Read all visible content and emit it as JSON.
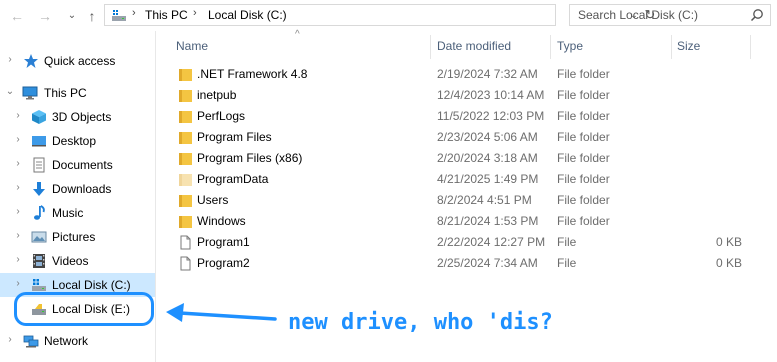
{
  "toolbar": {
    "back_glyph": "←",
    "forward_glyph": "→",
    "recent_glyph": "⌄",
    "up_glyph": "↑"
  },
  "address": {
    "crumbs": [
      "This PC",
      "Local Disk (C:)"
    ],
    "separator": "›",
    "dropdown_glyph": "⌄",
    "refresh_glyph": "↻"
  },
  "search": {
    "placeholder": "Search Local Disk (C:)"
  },
  "nav": {
    "chevron_collapsed": "›",
    "chevron_expanded": "⌄",
    "items": [
      {
        "label": "Quick access",
        "icon": "star-icon"
      },
      {
        "label": "This PC",
        "icon": "computer-icon",
        "expanded": true
      },
      {
        "label": "3D Objects",
        "icon": "cube-icon"
      },
      {
        "label": "Desktop",
        "icon": "desktop-icon"
      },
      {
        "label": "Documents",
        "icon": "documents-icon"
      },
      {
        "label": "Downloads",
        "icon": "download-arrow-icon"
      },
      {
        "label": "Music",
        "icon": "music-note-icon"
      },
      {
        "label": "Pictures",
        "icon": "pictures-icon"
      },
      {
        "label": "Videos",
        "icon": "film-strip-icon"
      },
      {
        "label": "Local Disk (C:)",
        "icon": "windows-drive-icon",
        "selected": true
      },
      {
        "label": "Local Disk (E:)",
        "icon": "usb-drive-icon"
      },
      {
        "label": "Network",
        "icon": "network-icon"
      }
    ]
  },
  "columns": {
    "name": "Name",
    "date": "Date modified",
    "type": "Type",
    "size": "Size"
  },
  "sort_indicator": "^",
  "files": [
    {
      "name": ".NET Framework 4.8",
      "date": "2/19/2024 7:32 AM",
      "type": "File folder",
      "size": "",
      "icon": "folder-icon"
    },
    {
      "name": "inetpub",
      "date": "12/4/2023 10:14 AM",
      "type": "File folder",
      "size": "",
      "icon": "folder-icon"
    },
    {
      "name": "PerfLogs",
      "date": "11/5/2022 12:03 PM",
      "type": "File folder",
      "size": "",
      "icon": "folder-icon"
    },
    {
      "name": "Program Files",
      "date": "2/23/2024 5:06 AM",
      "type": "File folder",
      "size": "",
      "icon": "folder-icon"
    },
    {
      "name": "Program Files (x86)",
      "date": "2/20/2024 3:18 AM",
      "type": "File folder",
      "size": "",
      "icon": "folder-icon"
    },
    {
      "name": "ProgramData",
      "date": "4/21/2025 1:49 PM",
      "type": "File folder",
      "size": "",
      "icon": "hidden-folder-icon"
    },
    {
      "name": "Users",
      "date": "8/2/2024 4:51 PM",
      "type": "File folder",
      "size": "",
      "icon": "folder-icon"
    },
    {
      "name": "Windows",
      "date": "8/21/2024 1:53 PM",
      "type": "File folder",
      "size": "",
      "icon": "folder-icon"
    },
    {
      "name": "Program1",
      "date": "2/22/2024 12:27 PM",
      "type": "File",
      "size": "0 KB",
      "icon": "file-icon"
    },
    {
      "name": "Program2",
      "date": "2/25/2024 7:34 AM",
      "type": "File",
      "size": "0 KB",
      "icon": "file-icon"
    }
  ],
  "annotation": {
    "text": "new drive, who 'dis?",
    "color": "#1e90ff"
  },
  "colors": {
    "selection": "#cce8ff",
    "folder": "#f4c542",
    "header_text": "#4c607a",
    "accent": "#1e90ff"
  }
}
